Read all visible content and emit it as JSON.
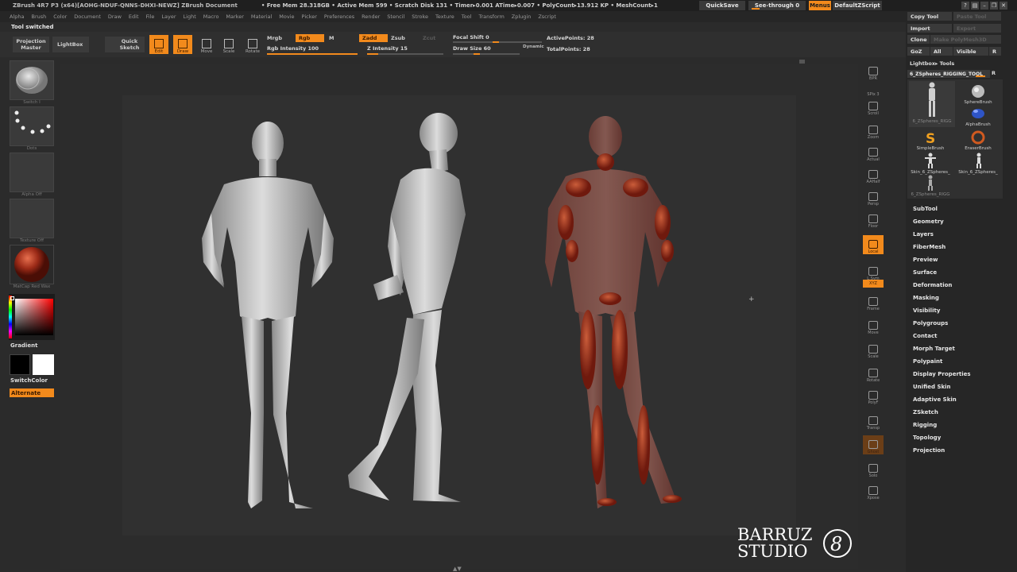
{
  "titlebar": {
    "title": "ZBrush 4R7 P3 (x64)[AOHG-NDUF-QNNS-DHXI-NEWZ]    ZBrush Document",
    "stats": "• Free Mem 28.318GB • Active Mem 599 • Scratch Disk 131 • Timer▸0.001 ATime▸0.007 • PolyCount▸13.912 KP • MeshCount▸1",
    "quicksave": "QuickSave",
    "see_through": "See-through  0",
    "menus": "Menus",
    "default_zscript": "DefaultZScript"
  },
  "menubar": [
    "Alpha",
    "Brush",
    "Color",
    "Document",
    "Draw",
    "Edit",
    "File",
    "Layer",
    "Light",
    "Macro",
    "Marker",
    "Material",
    "Movie",
    "Picker",
    "Preferences",
    "Render",
    "Stencil",
    "Stroke",
    "Texture",
    "Tool",
    "Transform",
    "Zplugin",
    "Zscript"
  ],
  "tool_message": "Tool switched",
  "shelf": {
    "projection_master": "Projection\nMaster",
    "lightbox": "LightBox",
    "quick_sketch": "Quick\nSketch",
    "edit": "Edit",
    "draw": "Draw",
    "move": "Move",
    "scale": "Scale",
    "rotate": "Rotate",
    "mrgb": "Mrgb",
    "rgb": "Rgb",
    "m": "M",
    "rgb_intensity": "Rgb Intensity 100",
    "zadd": "Zadd",
    "zsub": "Zsub",
    "zcut": "Zcut",
    "z_intensity": "Z Intensity 15",
    "focal_shift": "Focal Shift 0",
    "draw_size": "Draw Size 60",
    "dynamic": "Dynamic",
    "active_points": "ActivePoints: 28",
    "total_points": "TotalPoints: 28"
  },
  "left_tray": {
    "brush_caption": "Switch I",
    "stroke_caption": "Dots",
    "alpha_caption": "Alpha Off",
    "texture_caption": "Texture Off",
    "material_caption": "MatCap Red Wax",
    "gradient": "Gradient",
    "switch_color": "SwitchColor",
    "alternate": "Alternate"
  },
  "right_tray": [
    {
      "name": "bpr",
      "label": "BPR"
    },
    {
      "name": "spix",
      "label": "SPix 3"
    },
    {
      "name": "scroll",
      "label": "Scroll"
    },
    {
      "name": "zoom",
      "label": "Zoom"
    },
    {
      "name": "actual",
      "label": "Actual"
    },
    {
      "name": "aahalf",
      "label": "AAHalf"
    },
    {
      "name": "persp",
      "label": "Persp"
    },
    {
      "name": "floor",
      "label": "Floor"
    },
    {
      "name": "local",
      "label": "Local"
    },
    {
      "name": "lsym",
      "label": "L.Sym"
    },
    {
      "name": "xyz",
      "label": "XYZ"
    },
    {
      "name": "frame",
      "label": "Frame"
    },
    {
      "name": "move",
      "label": "Move"
    },
    {
      "name": "scale",
      "label": "Scale"
    },
    {
      "name": "rotate",
      "label": "Rotate"
    },
    {
      "name": "polyf",
      "label": "PolyF"
    },
    {
      "name": "transp",
      "label": "Transp"
    },
    {
      "name": "ghost",
      "label": "Ghost"
    },
    {
      "name": "solo",
      "label": "Solo"
    },
    {
      "name": "xpose",
      "label": "Xpose"
    }
  ],
  "right_panel": {
    "copy_tool": "Copy Tool",
    "paste_tool": "Paste Tool",
    "import": "Import",
    "export": "Export",
    "clone": "Clone",
    "make_polymesh": "Make PolyMesh3D",
    "goz": "GoZ",
    "all": "All",
    "visible": "Visible",
    "r": "R",
    "lightbox_tools": "Lightbox▸ Tools",
    "current_tool": "6_ZSpheres_RIGGING_TOOL",
    "current_tool_r": "R",
    "tools": [
      {
        "name": "rigging-figure",
        "label": "6_ZSpheres_RIGG"
      },
      {
        "name": "sphere-brush",
        "label": "SphereBrush"
      },
      {
        "name": "alpha-brush",
        "label": "AlphaBrush"
      },
      {
        "name": "simple-brush",
        "label": "SimpleBrush"
      },
      {
        "name": "eraser-brush",
        "label": "EraserBrush"
      },
      {
        "name": "skin-a",
        "label": "Skin_6_ZSpheres_"
      },
      {
        "name": "skin-b",
        "label": "Skin_6_ZSpheres_"
      },
      {
        "name": "zspheres-rig",
        "label": "6_ZSpheres_RIGG"
      }
    ],
    "menu": [
      "SubTool",
      "Geometry",
      "Layers",
      "FiberMesh",
      "Preview",
      "Surface",
      "Deformation",
      "Masking",
      "Visibility",
      "Polygroups",
      "Contact",
      "Morph Target",
      "Polypaint",
      "Display Properties",
      "Unified Skin",
      "Adaptive Skin",
      "ZSketch",
      "Rigging",
      "Topology",
      "Projection"
    ]
  },
  "watermark": {
    "line1": "BARRUZ",
    "line2": "STUDIO",
    "mark": "8"
  },
  "colors": {
    "accent": "#f28a1c",
    "bg": "#2b2b2b",
    "panel": "#262626"
  }
}
